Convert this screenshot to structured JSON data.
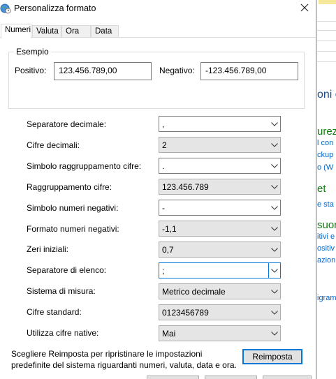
{
  "window": {
    "title": "Personalizza formato",
    "icon": "globe-clock-icon",
    "close_icon": "close-icon"
  },
  "tabs": [
    {
      "label": "Numeri",
      "active": true
    },
    {
      "label": "Valuta",
      "active": false
    },
    {
      "label": "Ora",
      "active": false
    },
    {
      "label": "Data",
      "active": false
    }
  ],
  "example": {
    "title": "Esempio",
    "positive_label": "Positivo:",
    "positive_value": "123.456.789,00",
    "negative_label": "Negativo:",
    "negative_value": "-123.456.789,00"
  },
  "settings": [
    {
      "label": "Separatore decimale:",
      "value": ",",
      "editable": true
    },
    {
      "label": "Cifre decimali:",
      "value": "2",
      "editable": false
    },
    {
      "label": "Simbolo raggruppamento cifre:",
      "value": ".",
      "editable": true
    },
    {
      "label": "Raggruppamento cifre:",
      "value": "123.456.789",
      "editable": false
    },
    {
      "label": "Simbolo numeri negativi:",
      "value": "-",
      "editable": true
    },
    {
      "label": "Formato numeri negativi:",
      "value": "-1,1",
      "editable": false
    },
    {
      "label": "Zeri iniziali:",
      "value": "0,7",
      "editable": false
    },
    {
      "label": "Separatore di elenco:",
      "value": ";",
      "editable": true,
      "focused": true
    },
    {
      "label": "Sistema di misura:",
      "value": "Metrico decimale",
      "editable": false
    },
    {
      "label": "Cifre standard:",
      "value": "0123456789",
      "editable": false
    },
    {
      "label": "Utilizza cifre native:",
      "value": "Mai",
      "editable": false
    }
  ],
  "footer": {
    "info_line1": "Scegliere Reimposta per ripristinare le impostazioni",
    "info_line2": "predefinite del sistema riguardanti numeri, valuta, data e ora.",
    "reset_label": "Reimposta"
  },
  "background_window": {
    "fragments": [
      "oni o",
      "urez",
      "l con",
      "ckup",
      "o (W",
      "et",
      "e sta",
      "suor",
      "itivi e",
      "ositiv",
      "azion",
      "igram"
    ],
    "link_color": "#0066cc",
    "heading_color": "#107c10"
  },
  "colors": {
    "accent": "#0078d7",
    "readonly_bg": "#e5e5e5"
  }
}
